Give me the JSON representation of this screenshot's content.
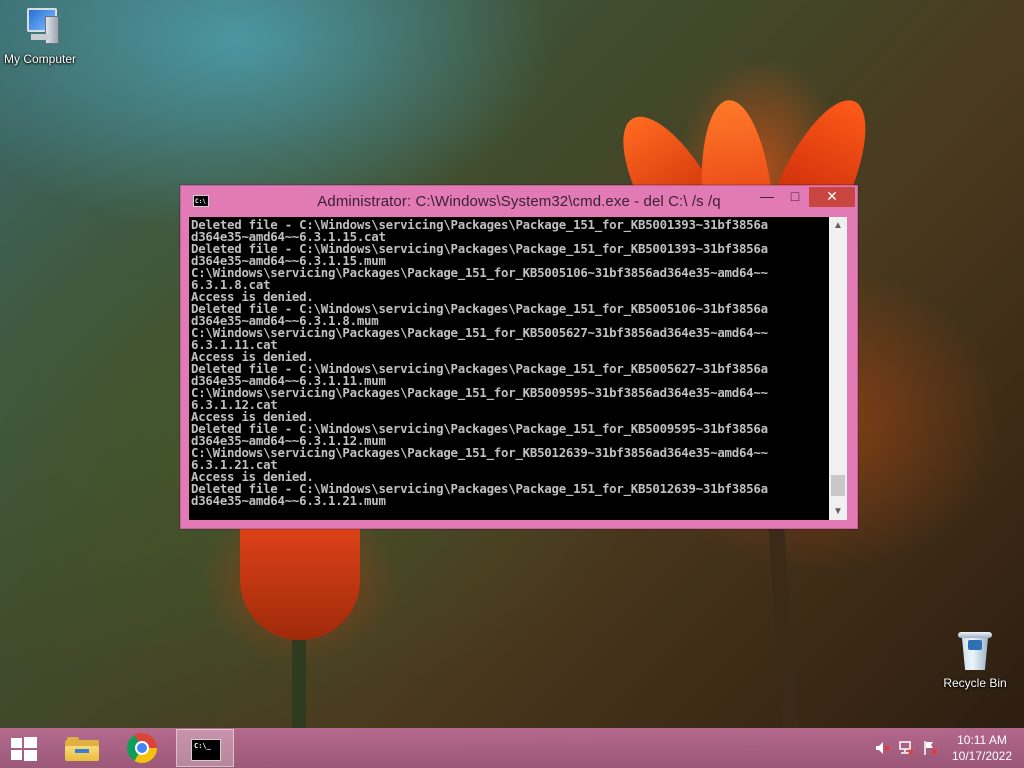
{
  "desktop": {
    "icons": [
      {
        "label": "My Computer",
        "icon": "computer-icon"
      },
      {
        "label": "Recycle Bin",
        "icon": "recycle-bin-icon"
      }
    ]
  },
  "window": {
    "title": "Administrator: C:\\Windows\\System32\\cmd.exe - del  C:\\ /s /q",
    "icon": "cmd-icon",
    "buttons": {
      "minimize": "—",
      "maximize": "□",
      "close": "✕"
    },
    "console_lines": [
      "Deleted file - C:\\Windows\\servicing\\Packages\\Package_151_for_KB5001393~31bf3856a",
      "d364e35~amd64~~6.3.1.15.cat",
      "Deleted file - C:\\Windows\\servicing\\Packages\\Package_151_for_KB5001393~31bf3856a",
      "d364e35~amd64~~6.3.1.15.mum",
      "C:\\Windows\\servicing\\Packages\\Package_151_for_KB5005106~31bf3856ad364e35~amd64~~",
      "6.3.1.8.cat",
      "Access is denied.",
      "Deleted file - C:\\Windows\\servicing\\Packages\\Package_151_for_KB5005106~31bf3856a",
      "d364e35~amd64~~6.3.1.8.mum",
      "C:\\Windows\\servicing\\Packages\\Package_151_for_KB5005627~31bf3856ad364e35~amd64~~",
      "6.3.1.11.cat",
      "Access is denied.",
      "Deleted file - C:\\Windows\\servicing\\Packages\\Package_151_for_KB5005627~31bf3856a",
      "d364e35~amd64~~6.3.1.11.mum",
      "C:\\Windows\\servicing\\Packages\\Package_151_for_KB5009595~31bf3856ad364e35~amd64~~",
      "6.3.1.12.cat",
      "Access is denied.",
      "Deleted file - C:\\Windows\\servicing\\Packages\\Package_151_for_KB5009595~31bf3856a",
      "d364e35~amd64~~6.3.1.12.mum",
      "C:\\Windows\\servicing\\Packages\\Package_151_for_KB5012639~31bf3856ad364e35~amd64~~",
      "6.3.1.21.cat",
      "Access is denied.",
      "Deleted file - C:\\Windows\\servicing\\Packages\\Package_151_for_KB5012639~31bf3856a",
      "d364e35~amd64~~6.3.1.21.mum"
    ],
    "scrollbar": {
      "up": "▲",
      "down": "▼",
      "position": 0.97
    }
  },
  "taskbar": {
    "start_icon": "windows-logo-icon",
    "pinned": [
      {
        "name": "File Explorer",
        "icon": "folder-icon"
      },
      {
        "name": "Google Chrome",
        "icon": "chrome-icon"
      },
      {
        "name": "Command Prompt",
        "icon": "cmd-icon",
        "active": true
      }
    ],
    "tray": {
      "icons": [
        "volume-muted-icon",
        "network-disconnected-icon",
        "action-center-flag-icon"
      ],
      "time": "10:11 AM",
      "date": "10/17/2022"
    }
  },
  "colors": {
    "window_frame": "#e27ab5",
    "close_button": "#c94540",
    "console_bg": "#000000",
    "console_text": "#c0c0c0",
    "taskbar": "#b46a92"
  }
}
